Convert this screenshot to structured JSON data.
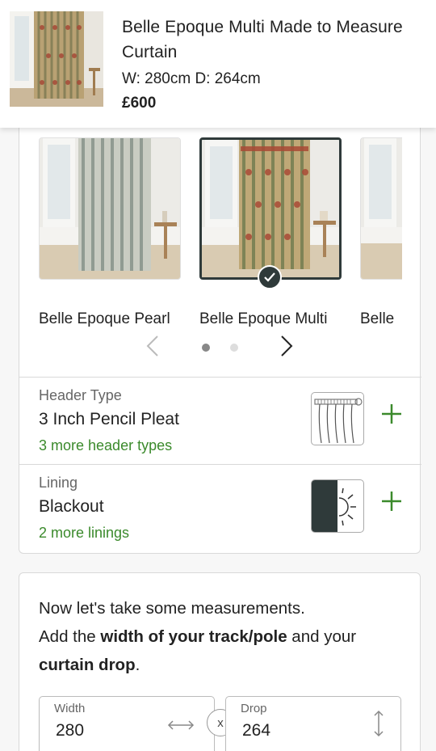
{
  "product": {
    "title": "Belle Epoque Multi Made to Measure Curtain",
    "dimensions": "W: 280cm D: 264cm",
    "price": "£600",
    "thumbnail_icon": "curtain-multi-thumbnail"
  },
  "swatches": [
    {
      "label": "Belle Epoque Pearl",
      "selected": false
    },
    {
      "label": "Belle Epoque Multi",
      "selected": true
    },
    {
      "label": "Belle",
      "selected": false
    }
  ],
  "pager": {
    "prev_icon": "chevron-left-icon",
    "next_icon": "chevron-right-icon",
    "page_count": 2,
    "active_page": 1
  },
  "header_type": {
    "label": "Header Type",
    "value": "3 Inch Pencil Pleat",
    "more": "3 more header types"
  },
  "lining": {
    "label": "Lining",
    "value": "Blackout",
    "more": "2 more linings"
  },
  "measure": {
    "line1": "Now let's take some measurements.",
    "line2_pre": "Add the ",
    "line2_bold": "width of your track/pole",
    "line2_post": " and your",
    "line3_bold": "curtain drop",
    "line3_post": ".",
    "width_label": "Width",
    "width_value": "280",
    "clear_label": "x",
    "drop_label": "Drop",
    "drop_value": "264"
  },
  "colors": {
    "accent_green": "#3b8a2c",
    "selected_border": "#2f3a3a"
  }
}
